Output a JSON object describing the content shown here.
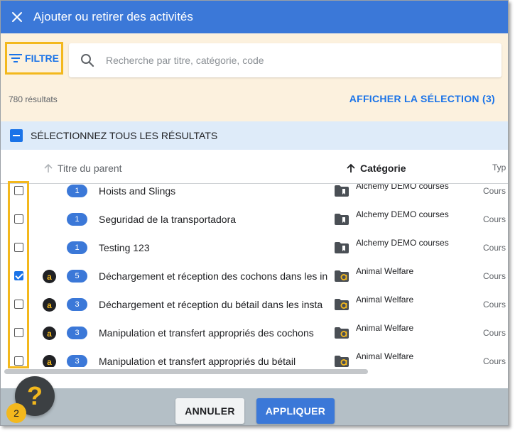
{
  "dialog": {
    "title": "Ajouter ou retirer des activités",
    "close_icon": "close-icon"
  },
  "filter": {
    "button_label": "FILTRE",
    "icon": "filter-lines-icon"
  },
  "search": {
    "placeholder": "Recherche par titre, catégorie, code",
    "value": "",
    "icon": "search-icon"
  },
  "results": {
    "count": "780 résultats",
    "show_selection_label": "AFFICHER LA SÉLECTION (3)"
  },
  "select_all": {
    "label": "SÉLECTIONNEZ TOUS LES RÉSULTATS",
    "state": "indeterminate"
  },
  "table": {
    "columns": [
      {
        "label": "Titre du parent",
        "sort_icon": "arrow-up-icon",
        "active": false
      },
      {
        "label": "Catégorie",
        "sort_icon": "arrow-up-icon",
        "active": true
      },
      {
        "label": "Typ"
      }
    ],
    "rows": [
      {
        "checked": false,
        "has_logo": false,
        "badge": "1",
        "title": "Hoists and Slings",
        "category": "Alchemy DEMO courses",
        "category_icon": "folder-bookmark-icon",
        "type": "Cours"
      },
      {
        "checked": false,
        "has_logo": false,
        "badge": "1",
        "title": "Seguridad de la transportadora",
        "category": "Alchemy DEMO courses",
        "category_icon": "folder-bookmark-icon",
        "type": "Cours"
      },
      {
        "checked": false,
        "has_logo": false,
        "badge": "1",
        "title": "Testing 123",
        "category": "Alchemy DEMO courses",
        "category_icon": "folder-bookmark-icon",
        "type": "Cours"
      },
      {
        "checked": true,
        "has_logo": true,
        "badge": "5",
        "title": "Déchargement et réception des cochons dans les in",
        "category": "Animal Welfare",
        "category_icon": "folder-a-icon",
        "type": "Cours"
      },
      {
        "checked": false,
        "has_logo": true,
        "badge": "3",
        "title": "Déchargement et réception du bétail dans les insta",
        "category": "Animal Welfare",
        "category_icon": "folder-a-icon",
        "type": "Cours"
      },
      {
        "checked": false,
        "has_logo": true,
        "badge": "3",
        "title": "Manipulation et transfert appropriés des cochons",
        "category": "Animal Welfare",
        "category_icon": "folder-a-icon",
        "type": "Cours"
      },
      {
        "checked": false,
        "has_logo": true,
        "badge": "3",
        "title": "Manipulation et transfert appropriés du bétail",
        "category": "Animal Welfare",
        "category_icon": "folder-a-icon",
        "type": "Cours"
      }
    ]
  },
  "footer": {
    "cancel_label": "ANNULER",
    "apply_label": "APPLIQUER"
  },
  "help": {
    "glyph": "?",
    "badge": "2"
  },
  "logo_letter": "a",
  "colors": {
    "primary": "#3b78d8",
    "accent_yellow": "#f3b81d",
    "filter_bg": "#fcf1de",
    "select_all_bg": "#deebf9",
    "footer_bg": "#b4bfc6"
  }
}
